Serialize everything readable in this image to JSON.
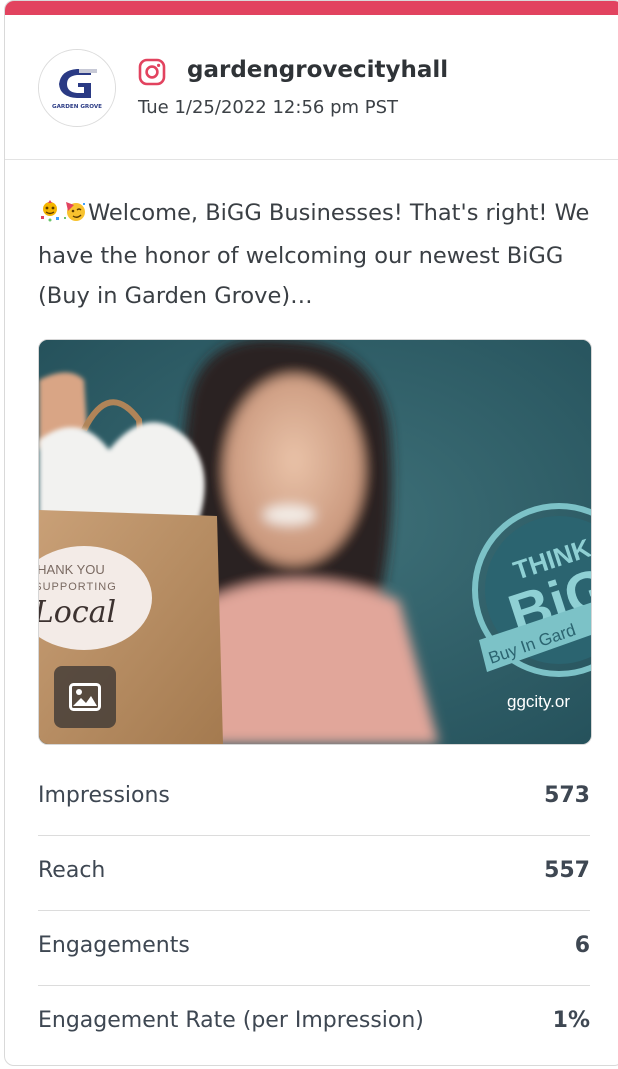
{
  "post": {
    "account_name": "gardengrovecityhall",
    "timestamp": "Tue 1/25/2022 12:56 pm PST",
    "network_icon": "instagram-icon",
    "caption": "Welcome, BiGG Businesses! That's right! We have the honor of welcoming our newest BiGG (Buy in Garden Grove)…",
    "avatar_text": "GARDEN GROVE"
  },
  "media": {
    "type_icon": "image-icon",
    "bag_sticker_line1": "THANK YOU",
    "bag_sticker_line2": "R SUPPORTING",
    "bag_sticker_line3": "Local",
    "badge_line1": "THINK",
    "badge_line2": "BiG",
    "badge_line3": "Buy In Gard",
    "url_text": "ggcity.or"
  },
  "metrics": [
    {
      "label": "Impressions",
      "value": "573"
    },
    {
      "label": "Reach",
      "value": "557"
    },
    {
      "label": "Engagements",
      "value": "6"
    },
    {
      "label": "Engagement Rate (per Impression)",
      "value": "1%"
    }
  ],
  "colors": {
    "accent": "#e2435f",
    "text": "#3e4752"
  }
}
